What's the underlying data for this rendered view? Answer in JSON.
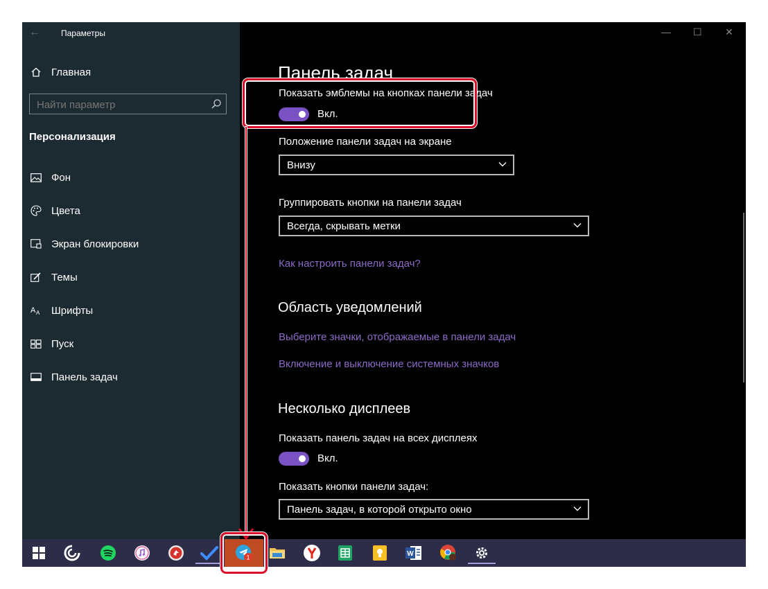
{
  "window": {
    "title": "Параметры",
    "controls": [
      "—",
      "☐",
      "✕"
    ]
  },
  "sidebar": {
    "home": {
      "label": "Главная",
      "icon": "home-icon"
    },
    "search": {
      "placeholder": "Найти параметр",
      "icon": "search-icon"
    },
    "section": "Персонализация",
    "items": [
      {
        "label": "Фон",
        "icon": "background-image-icon"
      },
      {
        "label": "Цвета",
        "icon": "palette-icon"
      },
      {
        "label": "Экран блокировки",
        "icon": "lock-screen-icon"
      },
      {
        "label": "Темы",
        "icon": "themes-brush-icon"
      },
      {
        "label": "Шрифты",
        "icon": "font-icon"
      },
      {
        "label": "Пуск",
        "icon": "start-grid-icon"
      },
      {
        "label": "Панель задач",
        "icon": "taskbar-icon"
      }
    ]
  },
  "main": {
    "page_title": "Панель задач",
    "badges": {
      "label": "Показать эмблемы на кнопках панели задач",
      "state": "Вкл.",
      "on": true
    },
    "position": {
      "label": "Положение панели задач на экране",
      "value": "Внизу"
    },
    "group": {
      "label": "Группировать кнопки на панели задач",
      "value": "Всегда, скрывать метки"
    },
    "help_link": "Как настроить панели задач?",
    "notification_area": {
      "heading": "Область уведомлений",
      "links": [
        "Выберите значки, отображаемые в панели задач",
        "Включение и выключение системных значков"
      ]
    },
    "multi_display": {
      "heading": "Несколько дисплеев",
      "show_all": {
        "label": "Показать панель задач на всех дисплеях",
        "state": "Вкл.",
        "on": true
      },
      "buttons": {
        "label": "Показать кнопки панели задач:",
        "value": "Панель задач, в которой открыто окно"
      }
    }
  },
  "taskbar": {
    "badge_count": "1",
    "items": [
      {
        "name": "start-icon"
      },
      {
        "name": "cortana-icon"
      },
      {
        "name": "spotify-icon"
      },
      {
        "name": "itunes-icon"
      },
      {
        "name": "red-app-icon"
      },
      {
        "name": "todo-check-icon"
      },
      {
        "name": "telegram-icon"
      },
      {
        "name": "file-explorer-icon"
      },
      {
        "name": "yandex-icon"
      },
      {
        "name": "sheets-icon"
      },
      {
        "name": "keep-icon"
      },
      {
        "name": "word-icon"
      },
      {
        "name": "chrome-icon"
      },
      {
        "name": "settings-gear-icon"
      }
    ]
  },
  "colors": {
    "accent": "#7b52c4",
    "link": "#8c6ac8",
    "sidebar_bg": "#1c2b32",
    "highlight": "#d90f2a",
    "taskbar_bg": "#2d2d4a"
  }
}
